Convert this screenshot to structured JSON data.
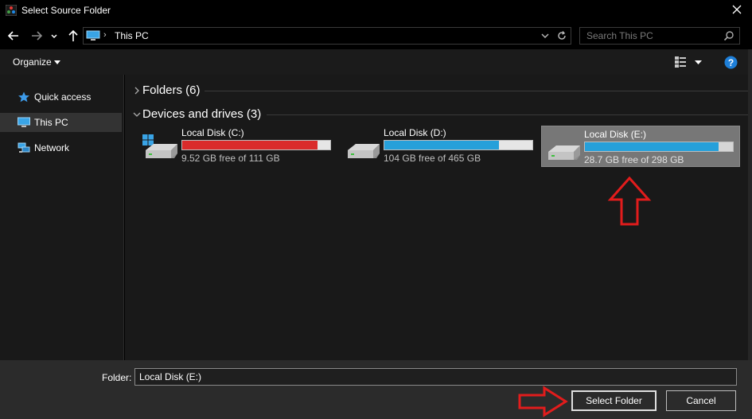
{
  "window": {
    "title": "Select Source Folder"
  },
  "address": {
    "location": "This PC",
    "separator": "›"
  },
  "search": {
    "placeholder": "Search This PC"
  },
  "toolbar": {
    "organize_label": "Organize"
  },
  "nav_pane": {
    "items": [
      {
        "label": "Quick access",
        "icon": "star-icon",
        "selected": false
      },
      {
        "label": "This PC",
        "icon": "computer-icon",
        "selected": true
      },
      {
        "label": "Network",
        "icon": "network-icon",
        "selected": false
      }
    ]
  },
  "content": {
    "groups": [
      {
        "label": "Folders (6)",
        "expanded": false
      },
      {
        "label": "Devices and drives (3)",
        "expanded": true
      }
    ],
    "drives": [
      {
        "name": "Local Disk (C:)",
        "free_text": "9.52 GB free of 111 GB",
        "used_fraction": 0.914,
        "bar_color": "#da2b2b",
        "system_drive": true,
        "selected": false
      },
      {
        "name": "Local Disk (D:)",
        "free_text": "104 GB free of 465 GB",
        "used_fraction": 0.776,
        "bar_color": "#26a0da",
        "system_drive": false,
        "selected": false
      },
      {
        "name": "Local Disk (E:)",
        "free_text": "28.7 GB free of 298 GB",
        "used_fraction": 0.904,
        "bar_color": "#26a0da",
        "system_drive": false,
        "selected": true
      }
    ]
  },
  "footer": {
    "folder_label": "Folder:",
    "folder_value": "Local Disk (E:)",
    "select_button": "Select Folder",
    "cancel_button": "Cancel"
  },
  "colors": {
    "accent": "#26a0da",
    "warning_bar": "#da2b2b",
    "annotation": "#e21c1c",
    "help": "#1e7fd8"
  }
}
